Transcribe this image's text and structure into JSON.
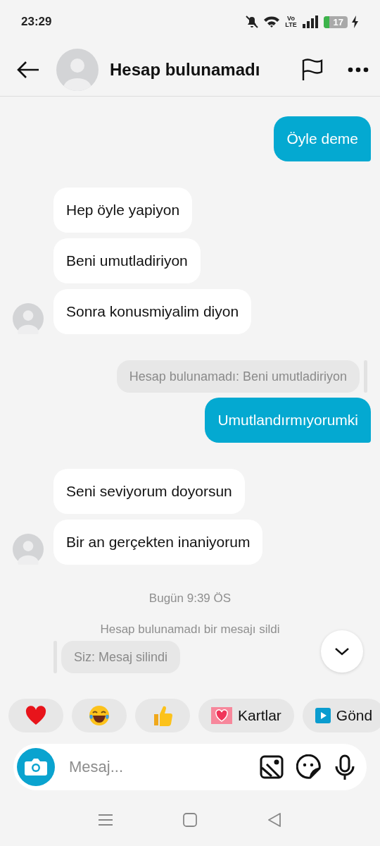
{
  "status_bar": {
    "time": "23:29",
    "network": "Vo LTE",
    "battery": "17"
  },
  "header": {
    "title": "Hesap bulunamadı"
  },
  "messages": [
    {
      "kind": "sent",
      "text": "Öyle deme"
    },
    {
      "kind": "received",
      "text": "Hep öyle yapiyon",
      "avatar": false
    },
    {
      "kind": "received",
      "text": "Beni umutladiriyon",
      "avatar": false
    },
    {
      "kind": "received",
      "text": "Sonra konusmiyalim diyon",
      "avatar": true
    },
    {
      "kind": "reply_quote",
      "text": "Hesap bulunamadı: Beni umutladiriyon"
    },
    {
      "kind": "sent",
      "text": "Umutlandırmıyorumki"
    },
    {
      "kind": "received",
      "text": "Seni seviyorum doyorsun",
      "avatar": false
    },
    {
      "kind": "received",
      "text": "Bir an gerçekten inaniyorum",
      "avatar": true
    },
    {
      "kind": "timestamp",
      "text": "Bugün 9:39 ÖS"
    },
    {
      "kind": "notice",
      "text": "Hesap bulunamadı bir mesajı sildi"
    },
    {
      "kind": "deleted_quote",
      "text": "Siz: Mesaj silindi"
    }
  ],
  "quick_replies": [
    {
      "kind": "heart"
    },
    {
      "kind": "laugh"
    },
    {
      "kind": "thumbs"
    },
    {
      "kind": "cards",
      "label": "Kartlar"
    },
    {
      "kind": "send",
      "label": "Gönd"
    }
  ],
  "composer": {
    "placeholder": "Mesaj..."
  }
}
